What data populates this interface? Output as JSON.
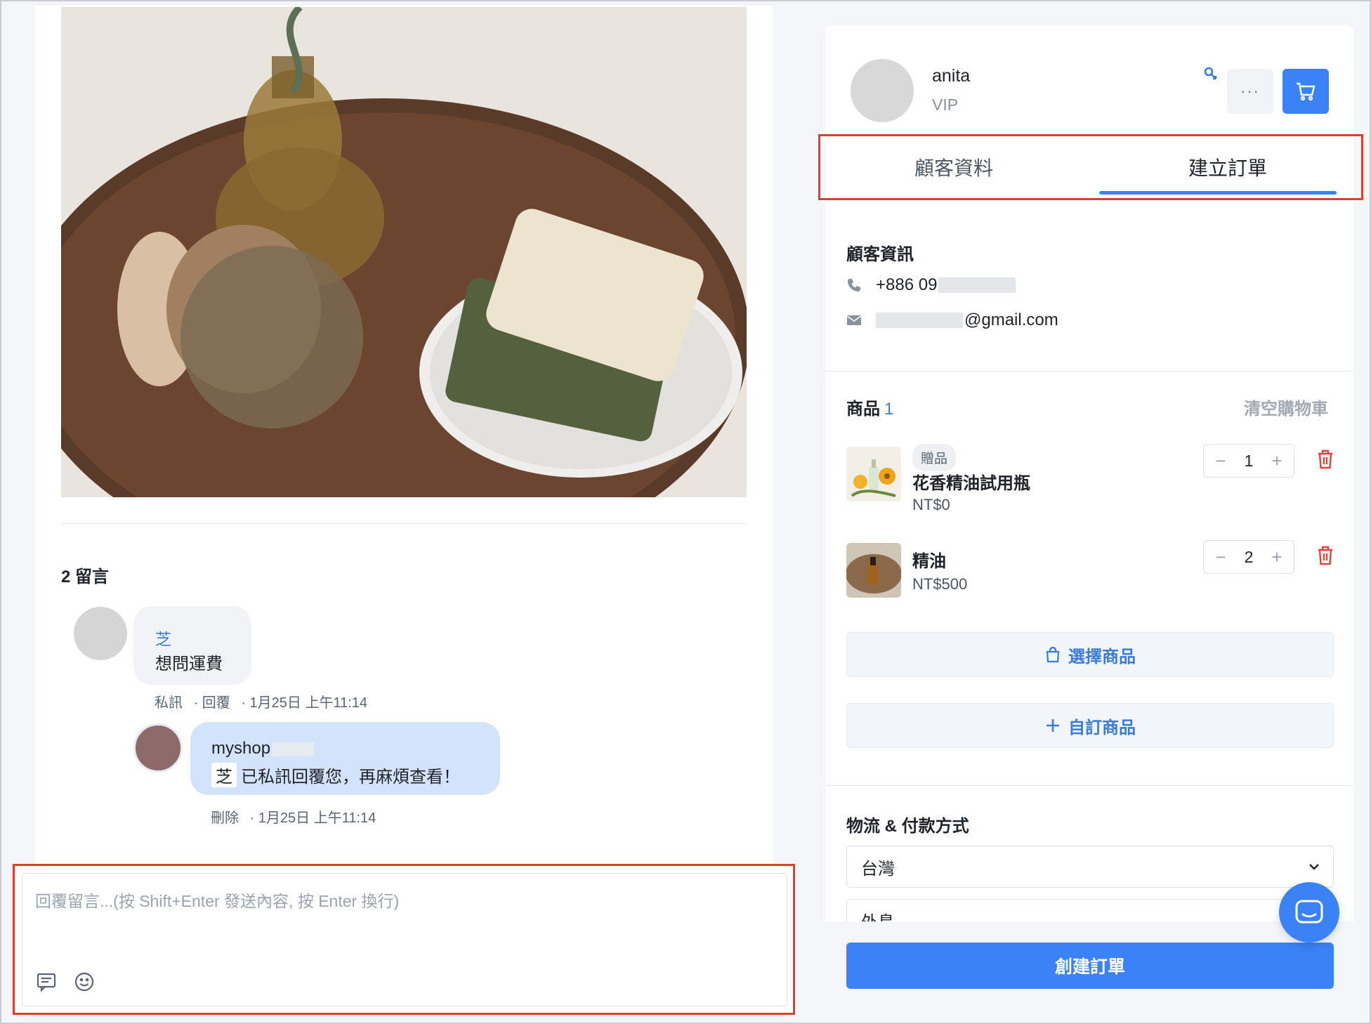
{
  "post": {
    "comments_count": "2 留言",
    "comments": [
      {
        "author": "芝",
        "text": "想問運費",
        "actions": [
          "私訊",
          "· 回覆",
          "· 1月25日 上午11:14"
        ]
      },
      {
        "author": "myshop",
        "mention": "芝",
        "text": "已私訊回覆您，再麻煩查看！",
        "actions": [
          "刪除",
          "· 1月25日 上午11:14"
        ]
      }
    ],
    "reply_placeholder": "回覆留言...(按 Shift+Enter 發送內容, 按 Enter 換行)"
  },
  "customer": {
    "name": "anita",
    "tier": "VIP",
    "tabs": [
      "顧客資料",
      "建立訂單"
    ],
    "active_tab": "建立訂單",
    "info_title": "顧客資訊",
    "phone": "+886 09",
    "email_suffix": "@gmail.com"
  },
  "order": {
    "products_title": "商品",
    "products_count": "1",
    "clear_cart": "清空購物車",
    "items": [
      {
        "badge": "贈品",
        "name": "花香精油試用瓶",
        "price": "NT$0",
        "qty": "1"
      },
      {
        "name": "精油",
        "price": "NT$500",
        "qty": "2"
      }
    ],
    "choose_products": "選擇商品",
    "custom_product": "自訂商品",
    "shipping_title": "物流 & 付款方式",
    "region": "台灣",
    "region_2": "外島",
    "create_order": "創建訂單"
  },
  "colors": {
    "accent": "#3b82f6",
    "highlight_border": "#d9412b",
    "delete": "#e0443a"
  }
}
